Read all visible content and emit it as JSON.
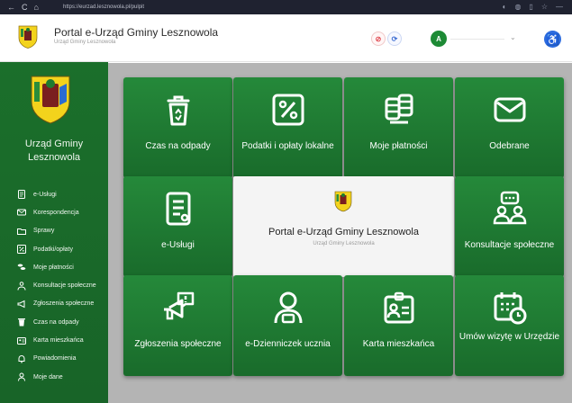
{
  "browser": {
    "url": "https://eurzad.lesznowola.pl/pulpit",
    "nav_back": "←",
    "nav_reload": "C",
    "nav_home": "⌂"
  },
  "header": {
    "title": "Portal e-Urząd Gminy Lesznowola",
    "subtitle": "Urząd Gminy Lesznowola",
    "icon1": "⊘",
    "icon2": "⟳",
    "user_icon": "A",
    "chevron": "⌄",
    "accessibility_icon": "♿"
  },
  "sidebar": {
    "title_line1": "Urząd Gminy",
    "title_line2": "Lesznowola",
    "items": [
      {
        "label": "e-Usługi",
        "icon": "document-icon"
      },
      {
        "label": "Korespondencja",
        "icon": "envelope-icon"
      },
      {
        "label": "Sprawy",
        "icon": "folder-icon"
      },
      {
        "label": "Podatki/opłaty",
        "icon": "percent-icon"
      },
      {
        "label": "Moje płatności",
        "icon": "coins-icon"
      },
      {
        "label": "Konsultacje społeczne",
        "icon": "people-icon"
      },
      {
        "label": "Zgłoszenia społeczne",
        "icon": "megaphone-icon"
      },
      {
        "label": "Czas na odpady",
        "icon": "bin-icon"
      },
      {
        "label": "Karta mieszkańca",
        "icon": "id-card-icon"
      },
      {
        "label": "Powiadomienia",
        "icon": "bell-icon"
      },
      {
        "label": "Moje dane",
        "icon": "user-icon"
      }
    ]
  },
  "tiles": {
    "odpady": "Czas na odpady",
    "podatki": "Podatki i opłaty lokalne",
    "platnosci": "Moje płatności",
    "odebrane": "Odebrane",
    "euslugi": "e-Usługi",
    "konsultacje": "Konsultacje społeczne",
    "zgloszenia": "Zgłoszenia społeczne",
    "dzienniczek": "e-Dzienniczek ucznia",
    "karta": "Karta mieszkańca",
    "wizyta": "Umów wizytę w Urzędzie"
  },
  "center_card": {
    "title": "Portal e-Urząd Gminy Lesznowola",
    "subtitle": "Urząd Gminy Lesznowola"
  },
  "colors": {
    "sidebar_green": "#1b6f2b",
    "tile_green": "#1f7d33",
    "accent_blue": "#2d6cdf"
  }
}
